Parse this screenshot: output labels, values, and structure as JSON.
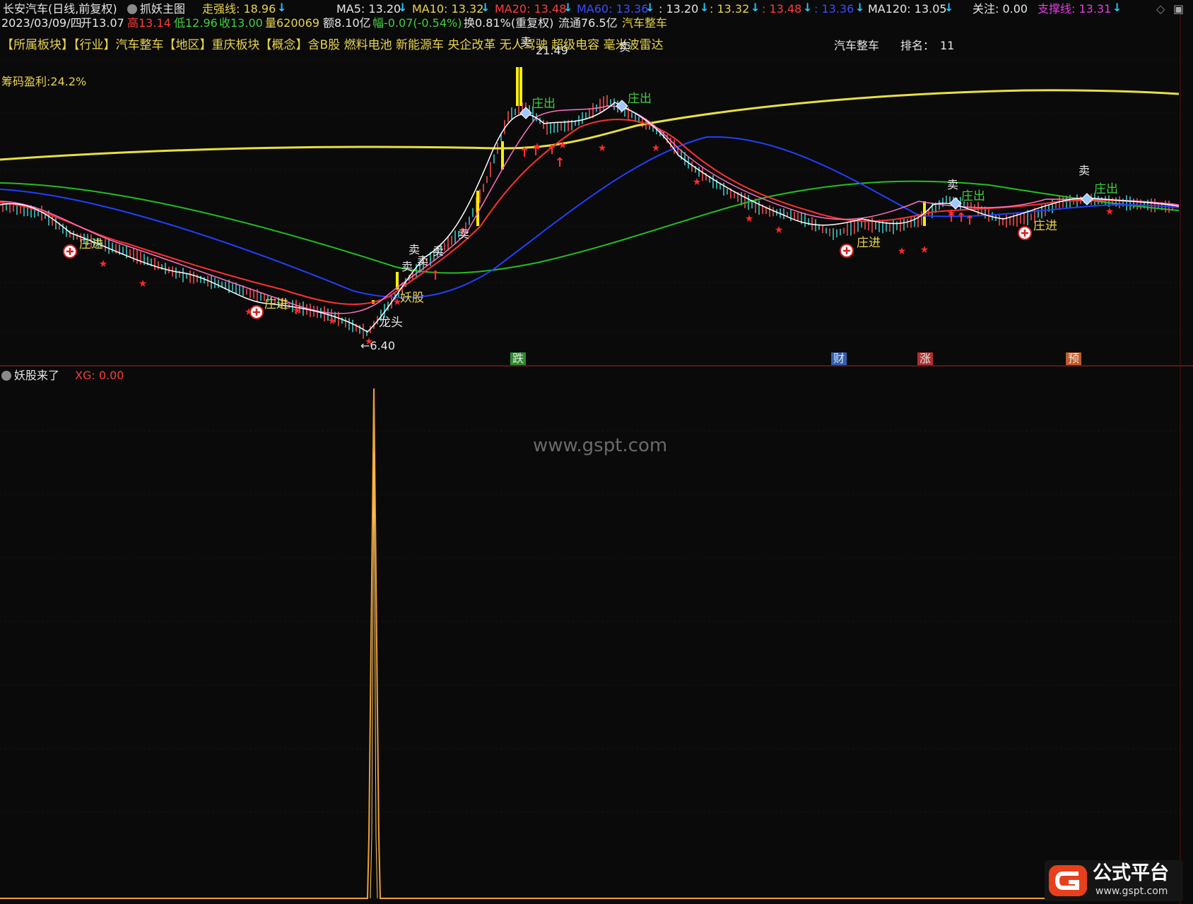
{
  "header": {
    "stock": "长安汽车(日线,前复权)",
    "indicator": "抓妖主图",
    "strong_label": "走强线: 18.96",
    "ma5": "MA5: 13.20",
    "ma10": "MA10: 13.32",
    "ma20": "MA20: 13.48",
    "ma60": "MA60: 13.36",
    "v1": ": 13.20",
    "v2": ": 13.32",
    "v3": ": 13.48",
    "v4": ": 13.36",
    "ma120": "MA120: 13.05",
    "focus": "关注: 0.00",
    "support": "支撑线: 13.31"
  },
  "info_row": {
    "date": "2023/03/09/四",
    "open": "开13.07",
    "high": "高13.14",
    "low": "低12.96",
    "close": "收13.00",
    "volume": "量620069",
    "amount": "额8.10亿",
    "change": "幅-0.07(-0.54%)",
    "turnover": "换0.81%(重复权)",
    "float": "流通76.5亿",
    "sector": "汽车整车"
  },
  "board_row": "【所属板块】【行业】汽车整车【地区】重庆板块【概念】含B股 燃料电池 新能源车 央企改革 无人驾驶 超级电容 毫米波雷达",
  "rank": {
    "sector": "汽车整车",
    "rank_label": "排名：",
    "rank_value": "11"
  },
  "chip_profit": "筹码盈利:24.2%",
  "annotations": {
    "high_price": "21.49",
    "low_price": "←6.40",
    "sell": "卖",
    "zhuang_in": "庄进",
    "zhuang_out": "庄出",
    "yaogu": "妖股",
    "longtou": "龙头"
  },
  "event_tags": [
    {
      "label": "跌",
      "color": "#2e8b2e"
    },
    {
      "label": "财",
      "color": "#2f5fb0"
    },
    {
      "label": "涨",
      "color": "#b03030"
    },
    {
      "label": "预",
      "color": "#c05a28"
    }
  ],
  "sub_panel": {
    "title": "妖股来了",
    "xg": "XG: 0.00"
  },
  "watermark": "www.gspt.com",
  "logo": {
    "name": "公式平台",
    "url": "www.gspt.com"
  },
  "colors": {
    "ma5": "#ffffff",
    "ma10": "#ffd700",
    "ma20": "#ff3030",
    "ma60": "#2040ff",
    "long_yellow": "#e8e040",
    "green_line": "#20c020",
    "xg": "#f0a030"
  },
  "chart_data": [
    {
      "type": "line",
      "title": "抓妖主图",
      "series": [
        {
          "name": "MA5",
          "values": [
            13.2
          ]
        },
        {
          "name": "MA10",
          "values": [
            13.32
          ]
        },
        {
          "name": "MA20",
          "values": [
            13.48
          ]
        },
        {
          "name": "MA60",
          "values": [
            13.36
          ]
        },
        {
          "name": "MA120",
          "values": [
            13.05
          ]
        }
      ],
      "price_range": [
        6.4,
        21.49
      ],
      "grid": true
    },
    {
      "type": "line",
      "title": "妖股来了",
      "series": [
        {
          "name": "XG",
          "values": [
            0,
            0,
            0,
            1,
            0,
            0,
            0
          ]
        }
      ],
      "ylim": [
        0,
        1
      ]
    }
  ]
}
